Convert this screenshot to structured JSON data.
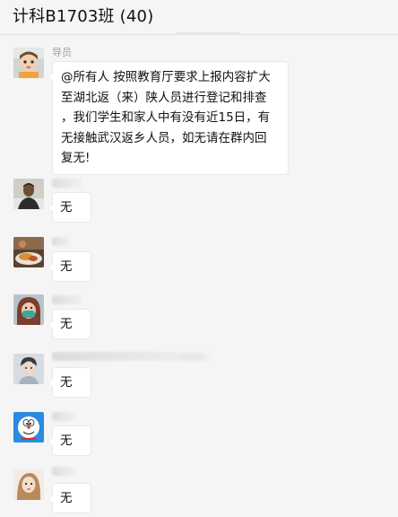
{
  "window": {
    "title": "计科B1703班 (40)"
  },
  "messages": [
    {
      "sender": "导员",
      "text": "@所有人 按照教育厅要求上报内容扩大\n至湖北返（来）陕人员进行登记和排查\n，我们学生和家人中有没有近15日，有\n无接触武汉返乡人员，如无请在群内回\n复无!",
      "avatar": "baby-photo-avatar"
    },
    {
      "sender": "",
      "text": "无",
      "avatar": "man-photo-avatar"
    },
    {
      "sender": "",
      "text": "无",
      "avatar": "food-photo-avatar"
    },
    {
      "sender": "",
      "text": "无",
      "avatar": "masked-person-avatar"
    },
    {
      "sender": "",
      "text": "无",
      "avatar": "young-man-avatar"
    },
    {
      "sender": "",
      "text": "无",
      "avatar": "doraemon-avatar"
    },
    {
      "sender": "",
      "text": "无",
      "avatar": "girl-photo-avatar"
    }
  ],
  "colors": {
    "background": "#f5f5f5",
    "bubble": "#ffffff",
    "sender_text": "#a0a0a0",
    "doraemon_blue": "#2a8be0"
  }
}
